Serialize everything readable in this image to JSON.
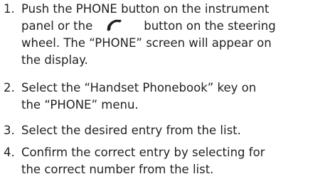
{
  "steps": [
    {
      "number": "1.",
      "line1_a": "Push the PHONE button on the instrument",
      "line2_a": "panel or the",
      "icon": "phone-handset-icon",
      "line2_b": "button on the steering",
      "line3": "wheel. The “PHONE” screen will appear on",
      "line4": "the display."
    },
    {
      "number": "2.",
      "line1": "Select the “Handset Phonebook” key on",
      "line2": "the “PHONE” menu."
    },
    {
      "number": "3.",
      "line1": "Select the desired entry from the list."
    },
    {
      "number": "4.",
      "line1": "Confirm the correct entry by selecting for",
      "line2": "the correct number from the list."
    }
  ]
}
